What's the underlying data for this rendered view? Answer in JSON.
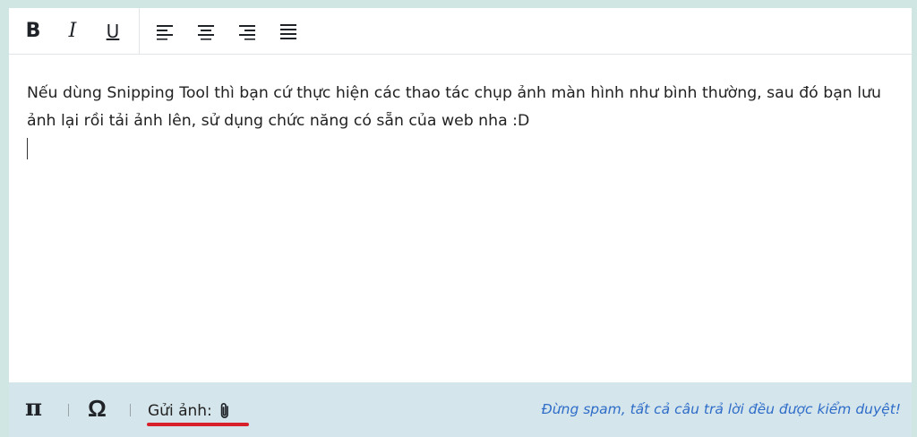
{
  "toolbar": {
    "bold_label": "B",
    "italic_label": "I",
    "underline_label": "U"
  },
  "content": {
    "text": "Nếu dùng Snipping Tool thì bạn cứ thực hiện các thao tác chụp ảnh màn hình như bình thường, sau đó bạn lưu ảnh lại rồi tải ảnh lên, sử dụng chức năng có sẵn của web nha :D"
  },
  "footer": {
    "pi_label": "π",
    "omega_label": "Ω",
    "upload_label": "Gửi ảnh:",
    "note": "Đừng spam, tất cả câu trả lời đều được kiểm duyệt!"
  },
  "colors": {
    "note_text": "#2f6cc8",
    "highlight_underline": "#d8202a"
  },
  "icons": {
    "align_left": "align-left-icon",
    "align_center": "align-center-icon",
    "align_right": "align-right-icon",
    "align_justify": "align-justify-icon",
    "attach": "paperclip-icon"
  }
}
